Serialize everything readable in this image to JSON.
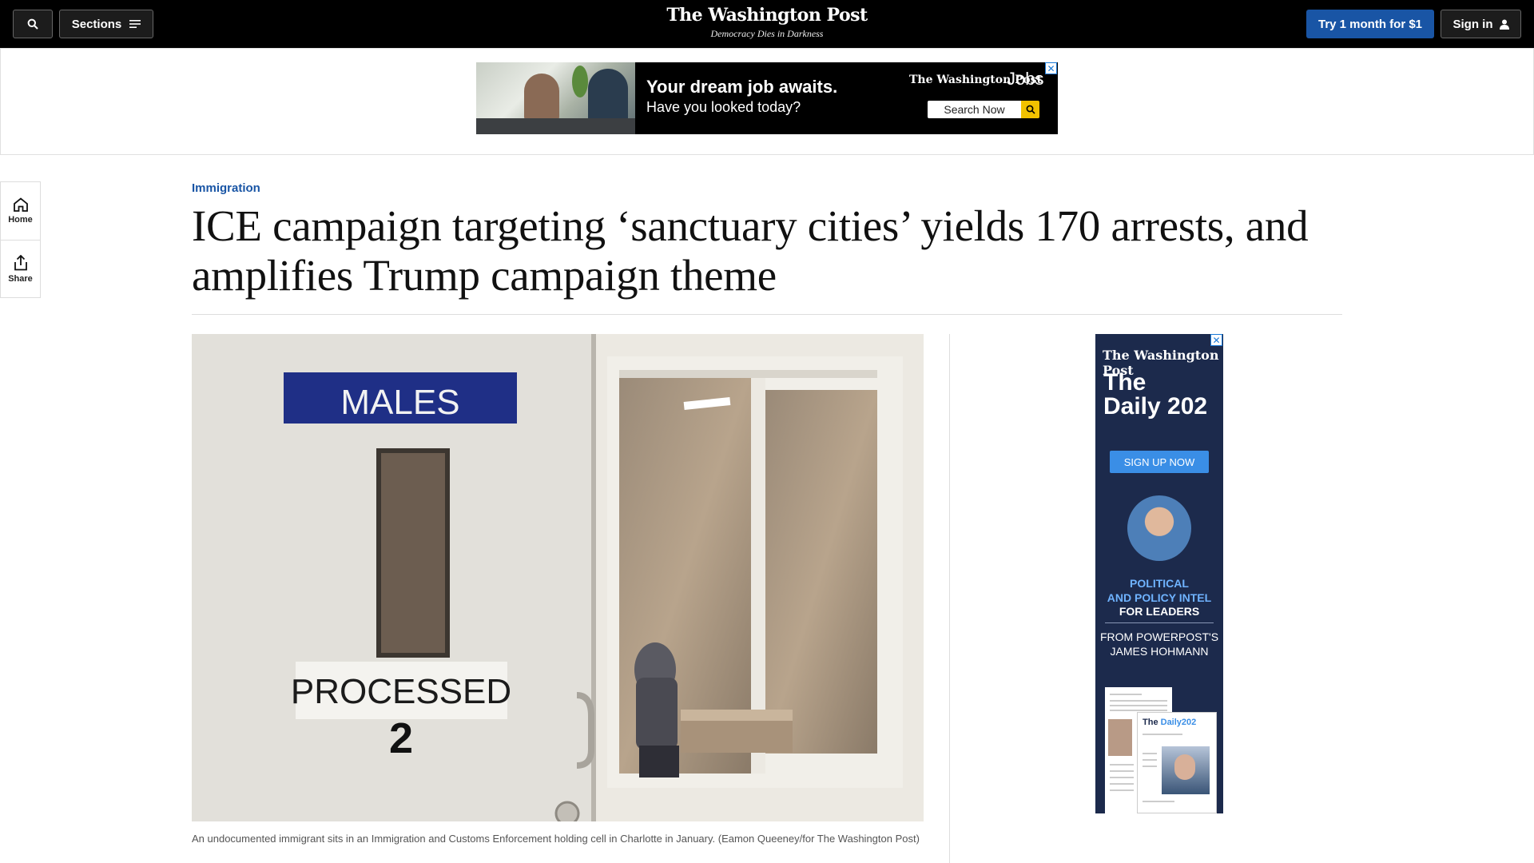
{
  "header": {
    "sections_label": "Sections",
    "logo": "The Washington Post",
    "tagline": "Democracy Dies in Darkness",
    "try_label": "Try 1 month for $1",
    "signin_label": "Sign in"
  },
  "leader_ad": {
    "headline": "Your dream job awaits.",
    "subline": "Have you looked today?",
    "brand": "The Washington Post",
    "product": "Jobs",
    "search_label": "Search Now"
  },
  "rail": {
    "home_label": "Home",
    "share_label": "Share"
  },
  "article": {
    "kicker": "Immigration",
    "headline": "ICE campaign targeting ‘sanctuary cities’ yields 170 arrests, and amplifies Trump campaign theme",
    "caption": "An undocumented immigrant sits in an Immigration and Customs Enforcement holding cell in Charlotte in January. (Eamon Queeney/for The Washington Post)",
    "photo_sign_top": "MALES",
    "photo_sign_bottom": "PROCESSED",
    "photo_number": "2"
  },
  "side_ad": {
    "logo": "The Washington Post",
    "title_line1": "The",
    "title_line2": "Daily 202",
    "button": "SIGN UP NOW",
    "intel_line1": "POLITICAL",
    "intel_line2": "AND POLICY INTEL",
    "intel_line3": "FOR LEADERS",
    "from_line1": "FROM POWERPOST'S",
    "from_line2": "JAMES HOHMANN",
    "paper_title_1": "The",
    "paper_title_2": "Daily202"
  },
  "icons": {
    "search": "search-icon",
    "menu": "menu-icon",
    "user": "user-icon",
    "home": "home-icon",
    "share": "share-icon",
    "ad_close": "close-icon"
  },
  "colors": {
    "topbar": "#000000",
    "accent_blue": "#1955a5",
    "ad_navy": "#1c2a4c"
  }
}
